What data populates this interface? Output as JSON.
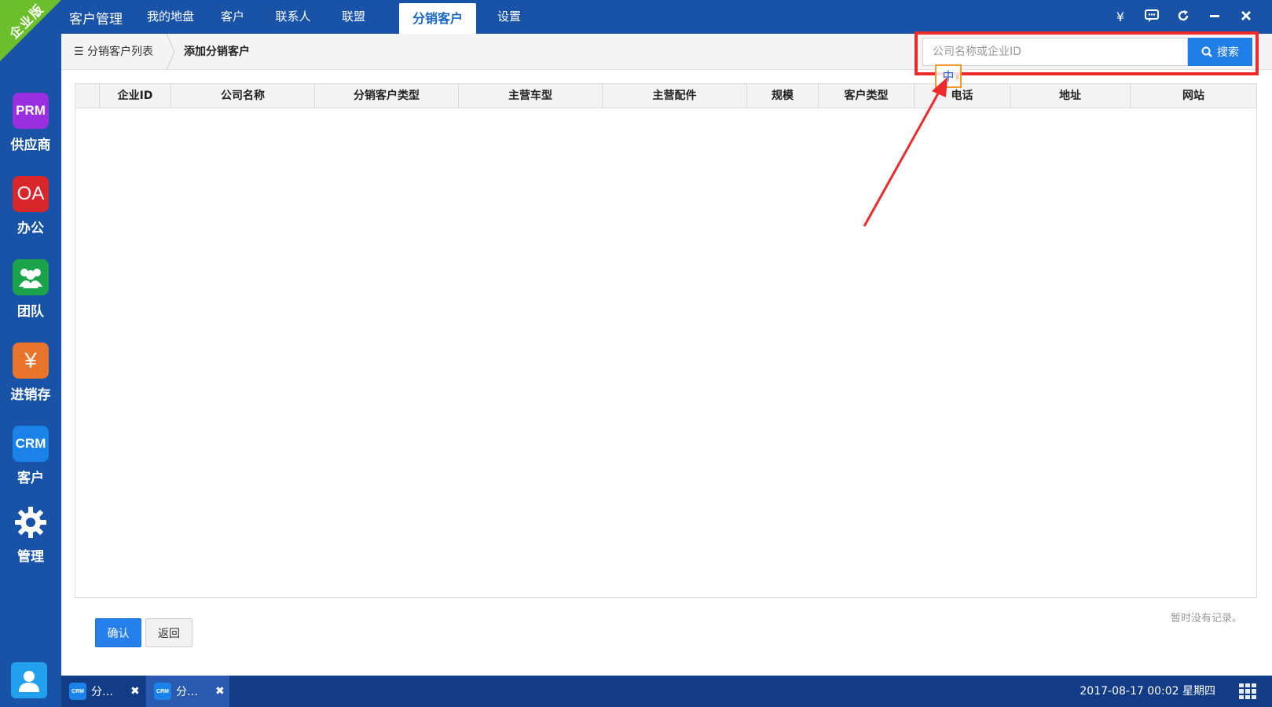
{
  "sidebar": {
    "edition_badge": "企业版",
    "items": [
      {
        "icon_text": "PRM",
        "label": "供应商",
        "color": "#9a2fe0"
      },
      {
        "icon_text": "OA",
        "label": "办公",
        "color": "#d9262b"
      },
      {
        "icon_text": "",
        "icon": "team-icon",
        "label": "团队",
        "color": "#1aa34a"
      },
      {
        "icon_text": "¥",
        "label": "进销存",
        "color": "#e8742c"
      },
      {
        "icon_text": "CRM",
        "label": "客户",
        "color": "#1a82e8"
      },
      {
        "icon_text": "",
        "icon": "gear-icon",
        "label": "管理",
        "color": "#1853a8"
      }
    ],
    "user_icon": "user-icon"
  },
  "header": {
    "app_title": "客户管理",
    "tabs": [
      {
        "label": "我的地盘"
      },
      {
        "label": "客户"
      },
      {
        "label": "联系人"
      },
      {
        "label": "联盟"
      },
      {
        "label": "分销客户",
        "active": true
      },
      {
        "label": "设置"
      }
    ],
    "icons": [
      "yen-icon",
      "chat-icon",
      "refresh-icon",
      "minimize-icon",
      "close-icon"
    ],
    "yen_symbol": "¥"
  },
  "breadcrumb": {
    "list_label": "分销客户列表",
    "current": "添加分销客户"
  },
  "search": {
    "placeholder": "公司名称或企业ID",
    "button_label": "搜索"
  },
  "table": {
    "columns": [
      "",
      "企业ID",
      "公司名称",
      "分销客户类型",
      "主营车型",
      "主营配件",
      "规模",
      "客户类型",
      "电话",
      "地址",
      "网站"
    ],
    "rows": []
  },
  "ime_indicator": {
    "char": "中",
    "sub": "s"
  },
  "empty_text": "暂时没有记录。",
  "actions": {
    "confirm_label": "确认",
    "back_label": "返回"
  },
  "taskbar": {
    "tasks": [
      {
        "icon_text": "CRM",
        "title": "分…"
      },
      {
        "icon_text": "CRM",
        "title": "分…",
        "active": true
      }
    ],
    "datetime": "2017-08-17 00:02 星期四"
  },
  "colors": {
    "brand": "#1853a8",
    "accent": "#1f7fe6",
    "highlight": "#ee2b2b"
  }
}
